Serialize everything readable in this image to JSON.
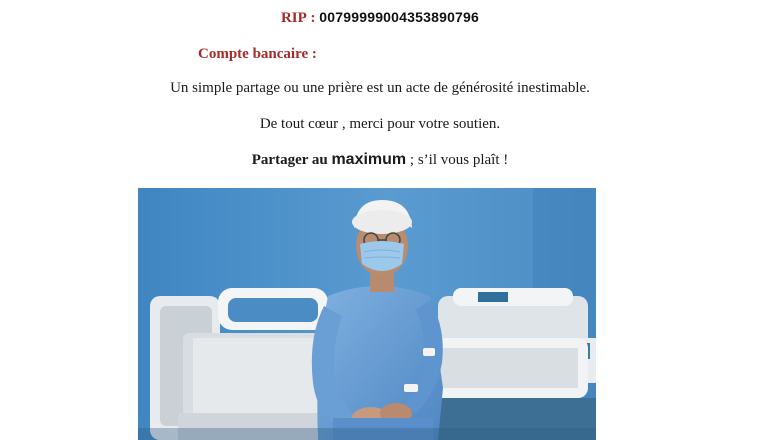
{
  "rip": {
    "label": "RIP",
    "separator": " : ",
    "number": "00799999004353890796"
  },
  "account_heading": "Compte bancaire :",
  "messages": {
    "line1": "Un simple partage ou une prière est un acte de générosité inestimable.",
    "line2": "De tout cœur , merci pour votre soutien.",
    "line3_part1": "Partager au ",
    "line3_emphasis": "maximum",
    "line3_part2": " ; s’il vous plaît !"
  },
  "photo": {
    "subject": "patient-in-hospital-ward-icon"
  },
  "colors": {
    "accent": "#a52a2a",
    "wall": "#4a8fc7",
    "gown": "#6ea2d8"
  }
}
